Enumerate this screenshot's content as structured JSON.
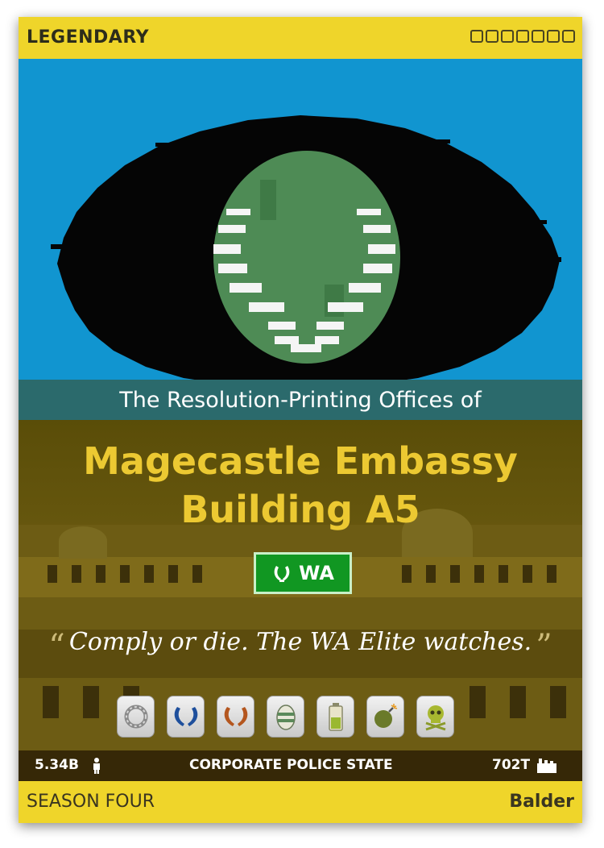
{
  "card": {
    "rarity": "LEGENDARY",
    "pretitle": "The Resolution-Printing Offices of",
    "name_line1": "Magecastle Embassy",
    "name_line2": "Building A5",
    "wa_label": "WA",
    "motto": "Comply or die. The WA Elite watches.",
    "quote_open": "“",
    "quote_close": "”",
    "population": "5.34B",
    "category": "CORPORATE POLICE STATE",
    "gdp": "702T",
    "season": "SEASON FOUR",
    "region": "Balder"
  },
  "badges": [
    {
      "icon": "ring-icon"
    },
    {
      "icon": "wa-delegate-laurel-icon"
    },
    {
      "icon": "wa-endorsement-laurel-icon"
    },
    {
      "icon": "easter-egg-icon"
    },
    {
      "icon": "battery-icon"
    },
    {
      "icon": "bomb-icon"
    },
    {
      "icon": "skull-crossbones-icon"
    }
  ],
  "colors": {
    "frame_yellow": "#efd52a",
    "flag_blue": "#1195d0",
    "name_gold": "#ecc932",
    "wa_green": "#119722"
  }
}
